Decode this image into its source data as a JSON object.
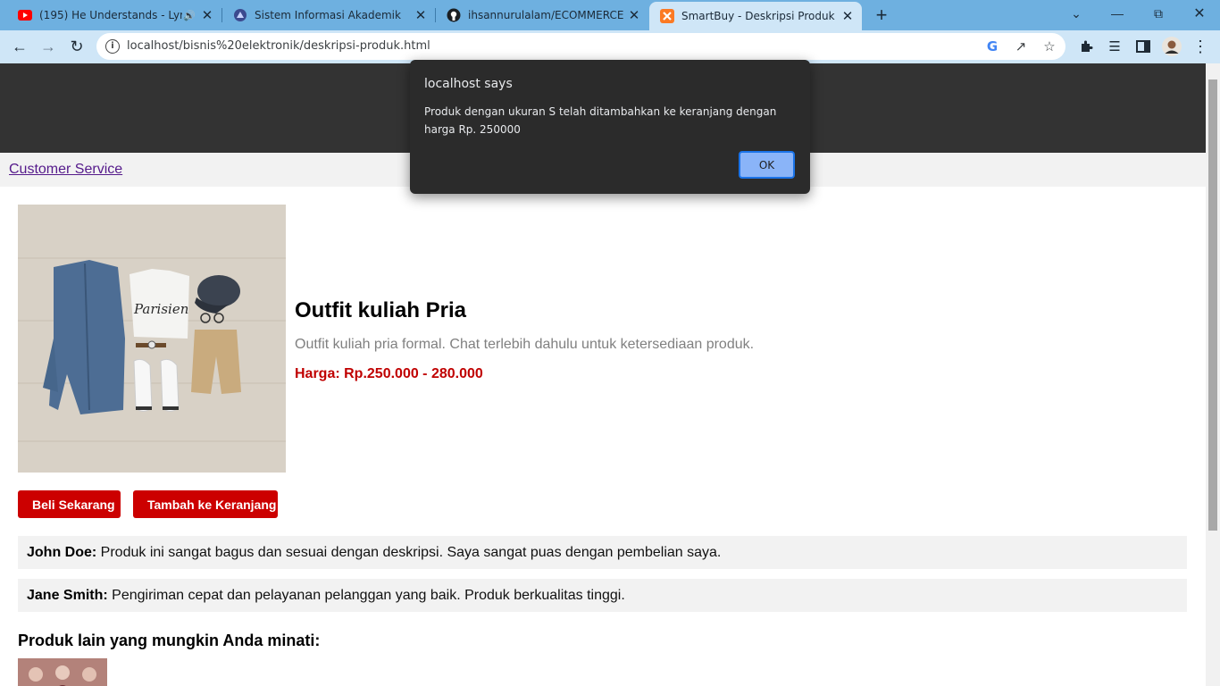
{
  "browser": {
    "tabs": [
      {
        "title": "(195) He Understands - Lyric",
        "icon": "youtube-icon",
        "active": false
      },
      {
        "title": "Sistem Informasi Akademik",
        "icon": "campus-icon",
        "active": false
      },
      {
        "title": "ihsannurulalam/ECOMMERCE",
        "icon": "github-icon",
        "active": false
      },
      {
        "title": "SmartBuy - Deskripsi Produk",
        "icon": "xampp-icon",
        "active": true
      }
    ],
    "url": "localhost/bisnis%20elektronik/deskripsi-produk.html"
  },
  "nav": {
    "customer_service": "Customer Service"
  },
  "product": {
    "title": "Outfit kuliah Pria",
    "description": "Outfit kuliah pria formal. Chat terlebih dahulu untuk ketersediaan produk.",
    "price": "Harga: Rp.250.000 - 280.000",
    "image_text": "Parisien"
  },
  "buttons": {
    "buy_now": "Beli Sekarang",
    "add_to_cart": "Tambah ke Keranjang"
  },
  "reviews": [
    {
      "name": "John Doe:",
      "text": "Produk ini sangat bagus dan sesuai dengan deskripsi. Saya sangat puas dengan pembelian saya."
    },
    {
      "name": "Jane Smith:",
      "text": "Pengiriman cepat dan pelayanan pelanggan yang baik. Produk berkualitas tinggi."
    }
  ],
  "related": {
    "title": "Produk lain yang mungkin Anda minati:"
  },
  "dialog": {
    "title": "localhost says",
    "message": "Produk dengan ukuran S telah ditambahkan ke keranjang dengan harga Rp. 250000",
    "ok_label": "OK"
  },
  "colors": {
    "header": "#333333",
    "accent": "#cc0000",
    "price": "#c00000"
  }
}
